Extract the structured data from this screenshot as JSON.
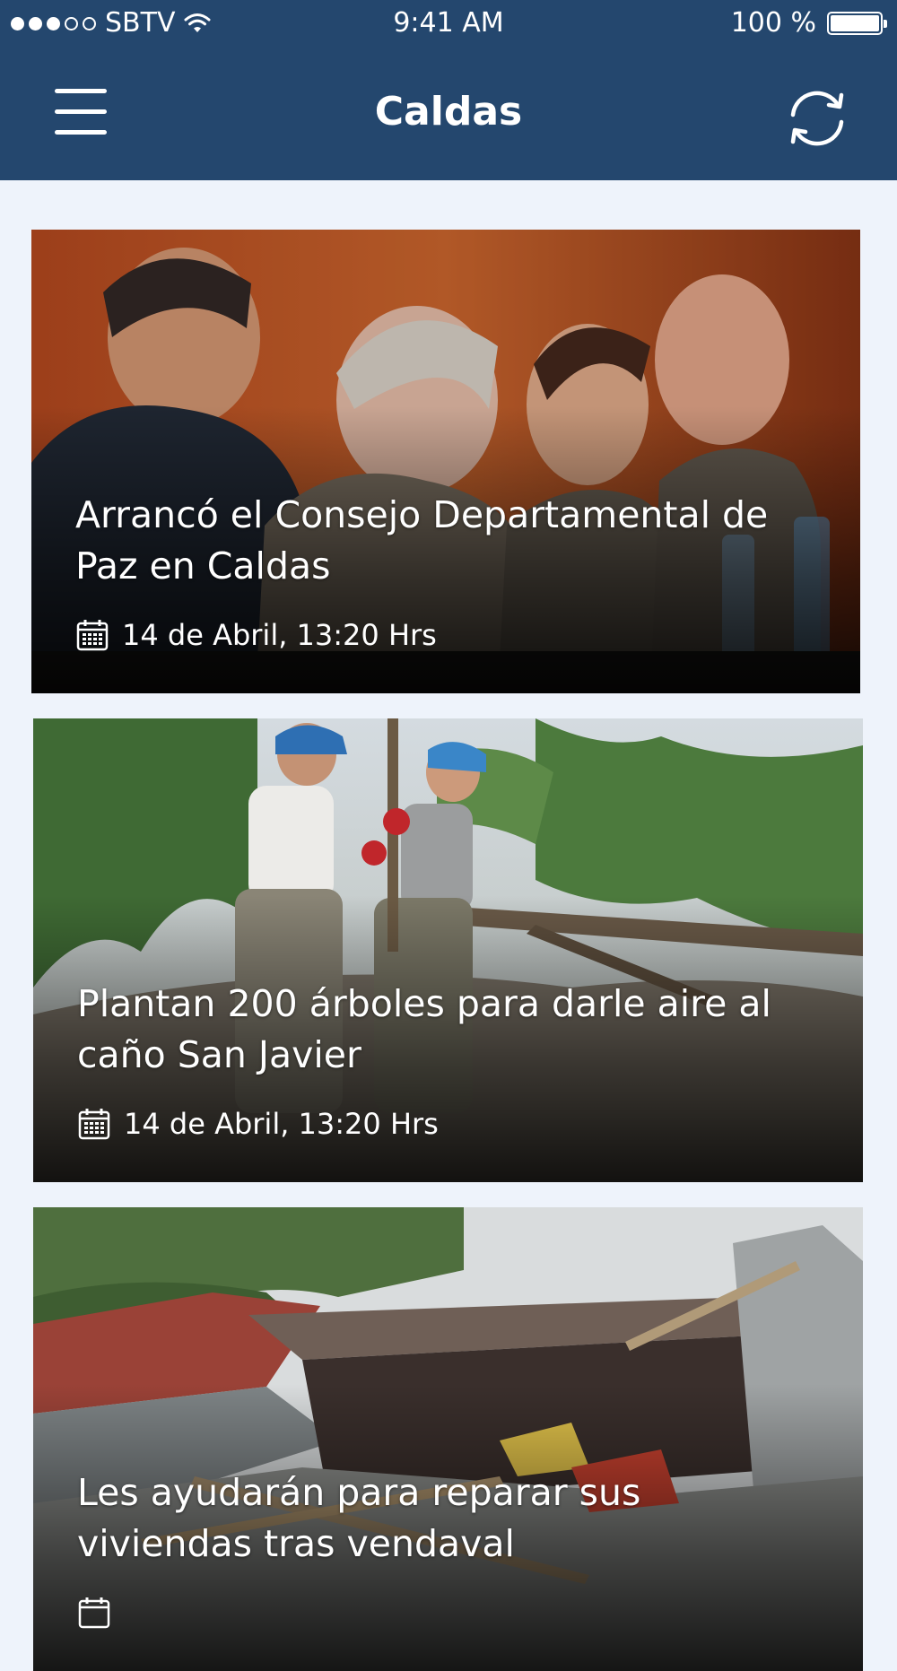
{
  "status_bar": {
    "carrier": "SBTV",
    "time": "9:41 AM",
    "battery_percent": "100 %",
    "signal_bars_filled": 3,
    "signal_bars_total": 5,
    "wifi_icon": "wifi-icon"
  },
  "header": {
    "title": "Caldas",
    "menu_icon": "hamburger-menu-icon",
    "refresh_icon": "refresh-icon",
    "background_color": "#24476e"
  },
  "news": [
    {
      "title": "Arrancó el Consejo Departamental de Paz en Caldas",
      "date": "14 de Abril, 13:20 Hrs",
      "image": "Photo: four people seated at a meeting table with water bottles"
    },
    {
      "title": "Plantan 200 árboles para darle aire al caño San Javier",
      "date": "14 de Abril, 13:20 Hrs",
      "image": "Photo: two volunteers in caps planting trees on a muddy bank"
    },
    {
      "title": "Les ayudarán para reparar sus viviendas tras vendaval",
      "date": "",
      "image": "Photo: collapsed metal roofs and debris after a windstorm"
    }
  ],
  "colors": {
    "page_background": "#eef3fb",
    "overlay_text": "#ffffff"
  }
}
